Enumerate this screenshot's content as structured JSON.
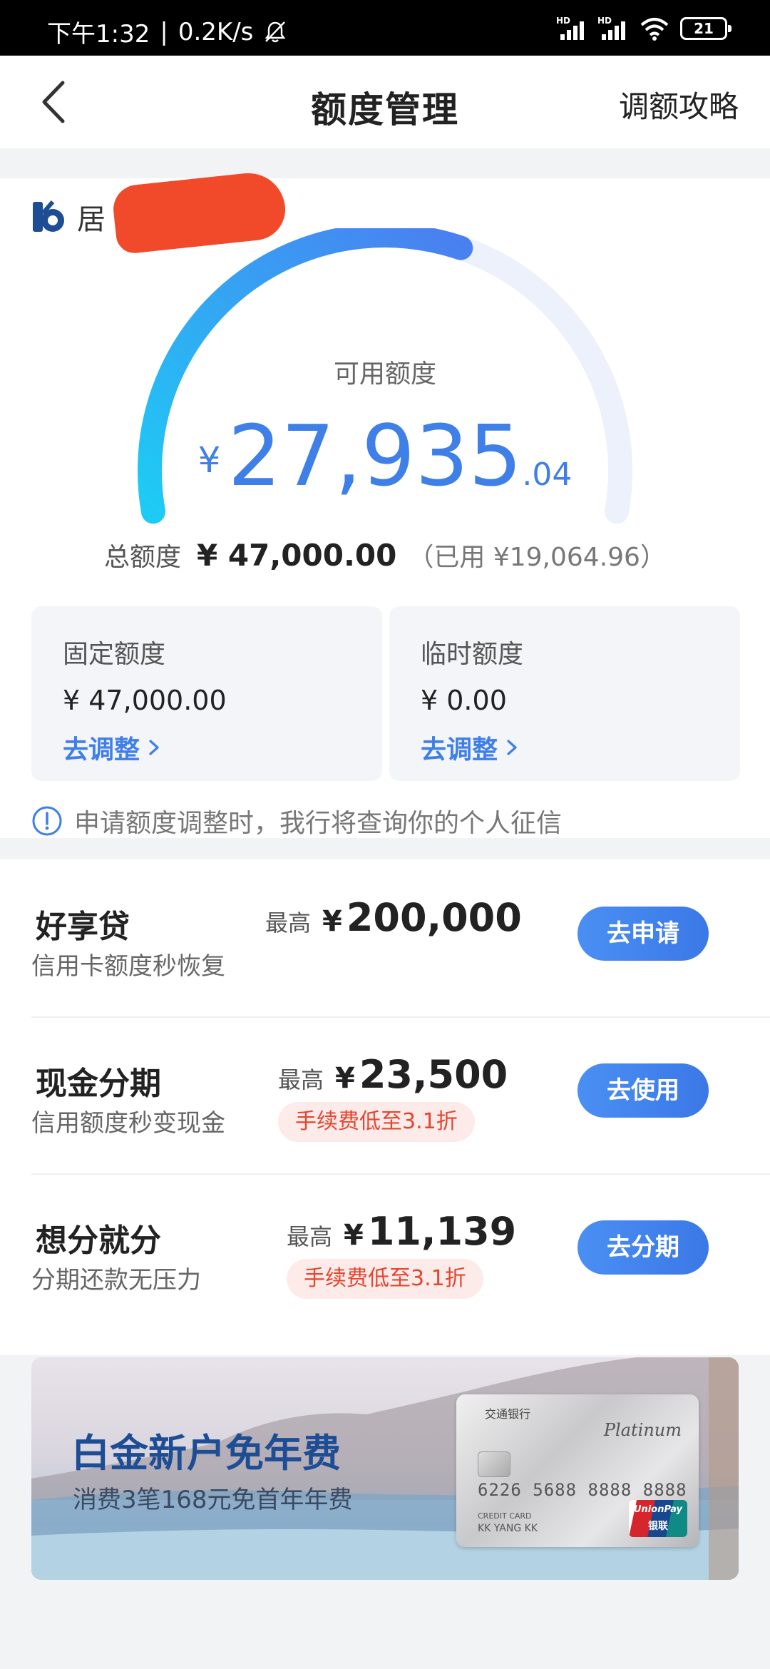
{
  "status_bar": {
    "time": "下午1:32",
    "speed": "0.2K/s",
    "hd_label": "HD",
    "battery": "21"
  },
  "nav": {
    "title": "额度管理",
    "strategy_label": "调额攻略"
  },
  "credit": {
    "bank_name": "居",
    "available_label": "可用额度",
    "currency": "¥",
    "available_integer": "27,935",
    "available_decimal": ".04",
    "gauge_fill": 0.594,
    "total_label": "总额度",
    "total_value": "¥ 47,000.00",
    "used_text": "（已用 ¥19,064.96）",
    "fixed": {
      "label": "固定额度",
      "value": "¥ 47,000.00",
      "action": "去调整"
    },
    "temporary": {
      "label": "临时额度",
      "value": "¥ 0.00",
      "action": "去调整"
    },
    "notice": "申请额度调整时，我行将查询你的个人征信"
  },
  "products": [
    {
      "name": "好享贷",
      "desc": "信用卡额度秒恢复",
      "max_label": "最高",
      "currency": "¥",
      "amount": "200,000",
      "fee": "",
      "button": "去申请"
    },
    {
      "name": "现金分期",
      "desc": "信用额度秒变现金",
      "max_label": "最高",
      "currency": "¥",
      "amount": "23,500",
      "fee": "手续费低至3.1折",
      "button": "去使用"
    },
    {
      "name": "想分就分",
      "desc": "分期还款无压力",
      "max_label": "最高",
      "currency": "¥",
      "amount": "11,139",
      "fee": "手续费低至3.1折",
      "button": "去分期"
    }
  ],
  "banner": {
    "title": "白金新户免年费",
    "subtitle": "消费3笔168元免首年年费",
    "card_bank": "交通银行",
    "card_tier": "Platinum",
    "card_number": "6226 5688 8888 8888",
    "card_type": "CREDIT CARD",
    "card_holder": "KK YANG KK",
    "card_network": "UnionPay",
    "card_network_cn": "银联"
  },
  "colors": {
    "accent": "#3f7fe8",
    "gauge_start": "#1ecbf5",
    "gauge_end": "#4a7ff0",
    "gauge_track": "#edf1fb",
    "fee_bg": "#fdebea",
    "fee_text": "#e4452f"
  }
}
